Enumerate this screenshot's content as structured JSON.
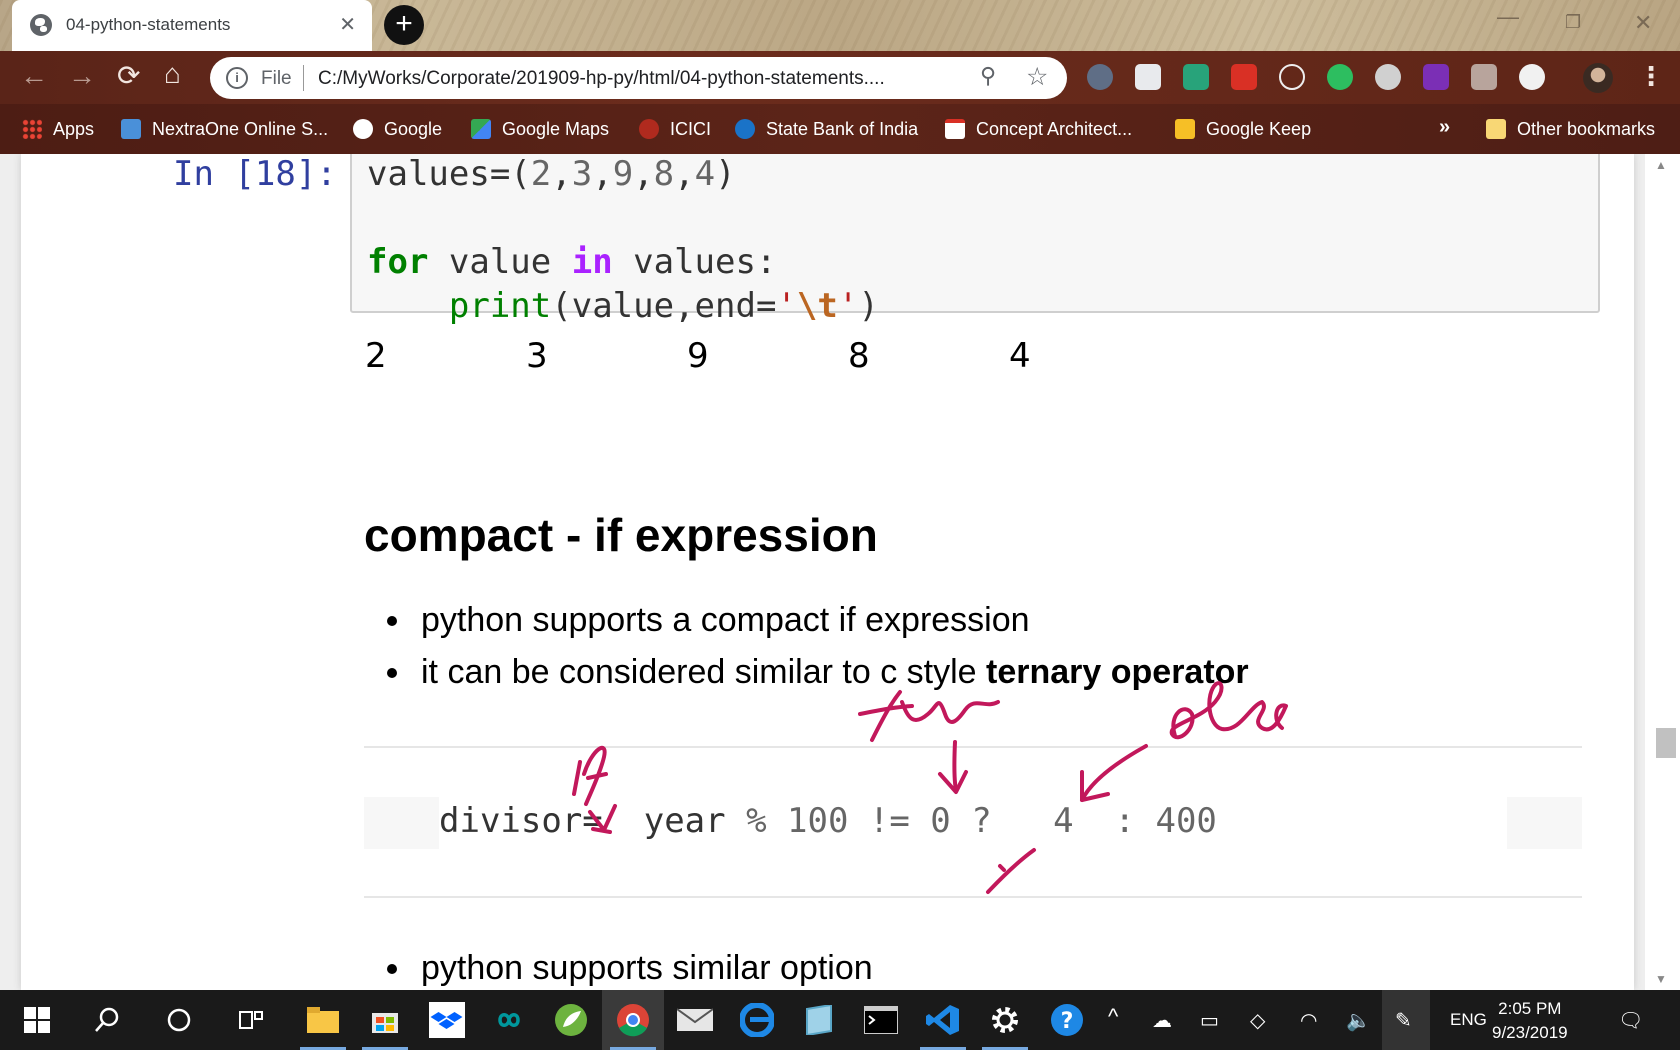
{
  "browser": {
    "tab_title": "04-python-statements",
    "new_tab_label": "+",
    "url_scheme": "File",
    "url": "C:/MyWorks/Corporate/201909-hp-py/html/04-python-statements....",
    "bookmarks": [
      {
        "label": "Apps",
        "icon": "apps-grid-icon",
        "color": "#e94235"
      },
      {
        "label": "NextraOne Online S...",
        "icon": "nextraone-icon",
        "color": "#4a90d9"
      },
      {
        "label": "Google",
        "icon": "google-icon",
        "color": "#ffffff"
      },
      {
        "label": "Google Maps",
        "icon": "google-maps-icon",
        "color": "#34a853"
      },
      {
        "label": "ICICI",
        "icon": "icici-icon",
        "color": "#b02a1e"
      },
      {
        "label": "State Bank of India",
        "icon": "sbi-icon",
        "color": "#1a73c8"
      },
      {
        "label": "Concept Architect...",
        "icon": "gmail-icon",
        "color": "#ffffff"
      },
      {
        "label": "Google Keep",
        "icon": "google-keep-icon",
        "color": "#f6bf26"
      }
    ],
    "more_bookmarks": "»",
    "other_bookmarks": "Other bookmarks"
  },
  "notebook": {
    "prompt": "In [18]:",
    "output_values": [
      "2",
      "3",
      "9",
      "8",
      "4"
    ],
    "heading": "compact - if expression",
    "bullets": [
      {
        "text": "python supports a compact if expression",
        "bold": ""
      },
      {
        "text": "it can be considered similar to c style ",
        "bold": "ternary operator"
      }
    ],
    "code_example_a": "divisor=",
    "code_example_b": "year",
    "code_example_c": " % 100 != 0 ? ",
    "code_example_d": "  4  : 400",
    "bullets2": [
      {
        "text": "python supports similar option",
        "bold": ""
      }
    ]
  },
  "taskbar": {
    "language": "ENG",
    "time": "2:05 PM",
    "date": "9/23/2019",
    "apps": [
      "start",
      "search",
      "cortana",
      "task-view",
      "file-explorer",
      "store",
      "dropbox",
      "arduino",
      "spring-tool-suite",
      "chrome",
      "mail",
      "edge",
      "notes",
      "terminal",
      "vscode",
      "settings",
      "help"
    ]
  },
  "colors": {
    "prompt": "#303f9f",
    "keyword": "#008000",
    "in_keyword": "#aa22ff",
    "string": "#ba2121",
    "ink": "#c2185b"
  }
}
